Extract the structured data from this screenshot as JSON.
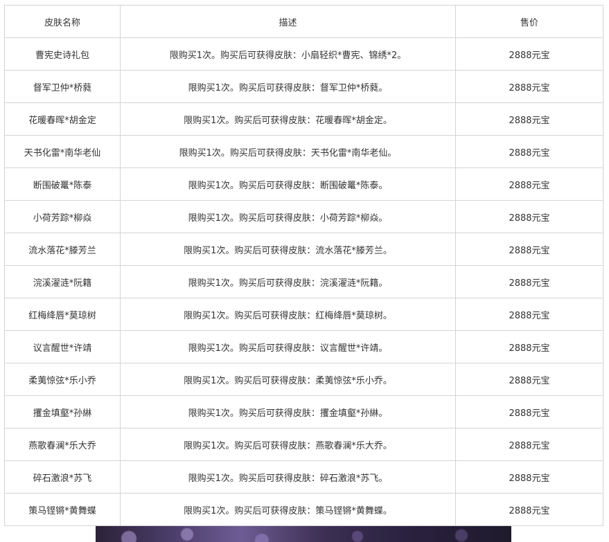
{
  "table": {
    "headers": {
      "name": "皮肤名称",
      "desc": "描述",
      "price": "售价"
    },
    "rows": [
      {
        "name": "曹宪史诗礼包",
        "desc": "限购买1次。购买后可获得皮肤：小扇轻织*曹宪、锦绣*2。",
        "price": "2888元宝"
      },
      {
        "name": "督军卫仲*桥蕤",
        "desc": "限购买1次。购买后可获得皮肤：督军卫仲*桥蕤。",
        "price": "2888元宝"
      },
      {
        "name": "花暖春晖*胡金定",
        "desc": "限购买1次。购买后可获得皮肤：花暖春晖*胡金定。",
        "price": "2888元宝"
      },
      {
        "name": "天书化雷*南华老仙",
        "desc": "限购买1次。购买后可获得皮肤：天书化雷*南华老仙。",
        "price": "2888元宝"
      },
      {
        "name": "断围破鼍*陈泰",
        "desc": "限购买1次。购买后可获得皮肤：断围破鼍*陈泰。",
        "price": "2888元宝"
      },
      {
        "name": "小荷芳踪*柳焱",
        "desc": "限购买1次。购买后可获得皮肤：小荷芳踪*柳焱。",
        "price": "2888元宝"
      },
      {
        "name": "流水落花*滕芳兰",
        "desc": "限购买1次。购买后可获得皮肤：流水落花*滕芳兰。",
        "price": "2888元宝"
      },
      {
        "name": "浣溪濯涟*阮籍",
        "desc": "限购买1次。购买后可获得皮肤：浣溪濯涟*阮籍。",
        "price": "2888元宝"
      },
      {
        "name": "红梅绛唇*莫琼树",
        "desc": "限购买1次。购买后可获得皮肤：红梅绛唇*莫琼树。",
        "price": "2888元宝"
      },
      {
        "name": "议言醒世*许靖",
        "desc": "限购买1次。购买后可获得皮肤：议言醒世*许靖。",
        "price": "2888元宝"
      },
      {
        "name": "柔荑惊弦*乐小乔",
        "desc": "限购买1次。购买后可获得皮肤：柔荑惊弦*乐小乔。",
        "price": "2888元宝"
      },
      {
        "name": "攫金填壑*孙綝",
        "desc": "限购买1次。购买后可获得皮肤：攫金填壑*孙綝。",
        "price": "2888元宝"
      },
      {
        "name": "燕歌春澜*乐大乔",
        "desc": "限购买1次。购买后可获得皮肤：燕歌春澜*乐大乔。",
        "price": "2888元宝"
      },
      {
        "name": "碎石激浪*苏飞",
        "desc": "限购买1次。购买后可获得皮肤：碎石激浪*苏飞。",
        "price": "2888元宝"
      },
      {
        "name": "策马铿锵*黄舞蝶",
        "desc": "限购买1次。购买后可获得皮肤：策马铿锵*黄舞蝶。",
        "price": "2888元宝"
      }
    ]
  }
}
